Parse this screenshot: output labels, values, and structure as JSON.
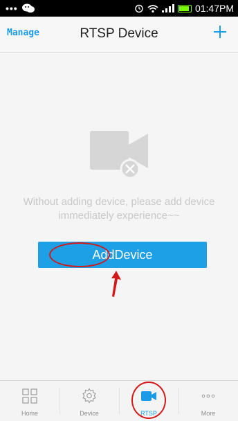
{
  "status_bar": {
    "left_icons": [
      "more-dots-icon",
      "wechat-icon"
    ],
    "right_icons": [
      "alarm-icon",
      "wifi-icon",
      "signal-icon",
      "battery-icon"
    ],
    "time": "01:47PM"
  },
  "nav": {
    "manage_label": "Manage",
    "title": "RTSP Device",
    "add_icon": "plus-icon"
  },
  "empty_state": {
    "icon": "camera-off-icon",
    "message": "Without adding device, please add device immediately experience~~"
  },
  "add_button": {
    "label": "AddDevice"
  },
  "tabs": [
    {
      "label": "Home",
      "icon": "grid-icon",
      "active": false
    },
    {
      "label": "Device",
      "icon": "gear-icon",
      "active": false
    },
    {
      "label": "RTSP",
      "icon": "video-camera-icon",
      "active": true
    },
    {
      "label": "More",
      "icon": "more-dots-icon",
      "active": false
    }
  ],
  "colors": {
    "accent": "#1a9be8",
    "button": "#1ea0e6",
    "annotation": "#d21a1a"
  }
}
